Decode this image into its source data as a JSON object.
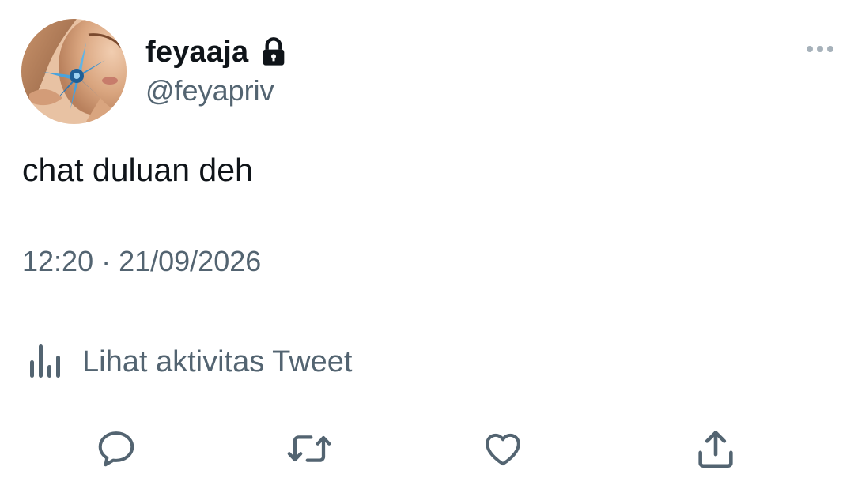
{
  "tweet": {
    "author": {
      "display_name": "feyaaja",
      "handle": "@feyapriv",
      "protected_icon": "lock-icon"
    },
    "text": "chat duluan deh",
    "timestamp": "12:20 · 21/09/2026",
    "activity_label": "Lihat aktivitas Tweet"
  },
  "actions": [
    {
      "name": "reply",
      "icon": "reply-icon"
    },
    {
      "name": "retweet",
      "icon": "retweet-icon"
    },
    {
      "name": "like",
      "icon": "heart-icon"
    },
    {
      "name": "share",
      "icon": "share-icon"
    }
  ],
  "colors": {
    "text_primary": "#0f1419",
    "text_secondary": "#536471",
    "icon_gray": "#536471",
    "more_dots": "#a6b1ba",
    "background": "#ffffff"
  }
}
